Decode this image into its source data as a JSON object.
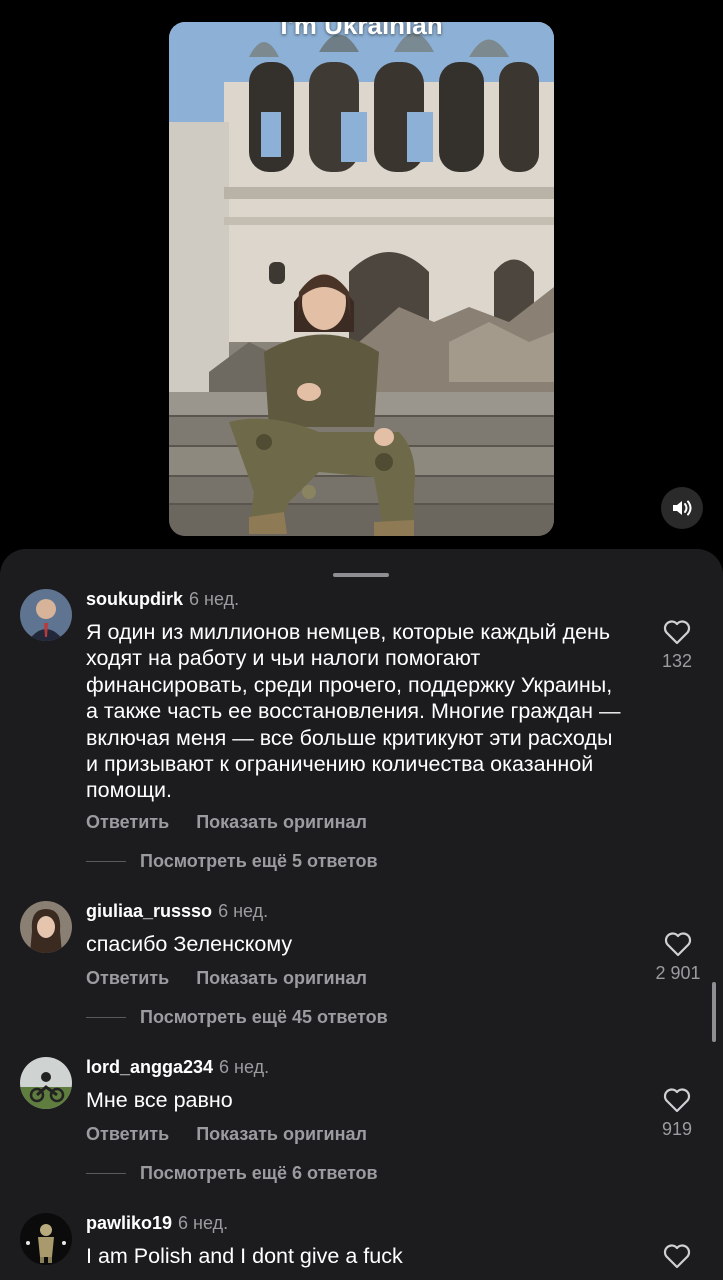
{
  "video": {
    "caption": "I'm Ukrainian"
  },
  "icons": {
    "volume": "volume-icon",
    "like": "heart-icon"
  },
  "comments": [
    {
      "username": "soukupdirk",
      "time": "6 нед.",
      "text": "Я один из миллионов немцев, которые каждый день ходят на работу и чьи налоги помогают финансировать, среди прочего, поддержку Украины, а также часть ее восстановления. Многие граждан — включая меня — все больше критикуют эти расходы и призывают к ограничению количества оказанной помощи.",
      "reply": "Ответить",
      "show_original": "Показать оригинал",
      "view_replies": "Посмотреть ещё 5 ответов",
      "likes": "132"
    },
    {
      "username": "giuliaa_russso",
      "time": "6 нед.",
      "text": "спасибо Зеленскому",
      "reply": "Ответить",
      "show_original": "Показать оригинал",
      "view_replies": "Посмотреть ещё 45 ответов",
      "likes": "2 901"
    },
    {
      "username": "lord_angga234",
      "time": "6 нед.",
      "text": "Мне все равно",
      "reply": "Ответить",
      "show_original": "Показать оригинал",
      "view_replies": "Посмотреть ещё 6 ответов",
      "likes": "919"
    },
    {
      "username": "pawliko19",
      "time": "6 нед.",
      "text": "I am Polish and I dont give a fuck"
    }
  ]
}
